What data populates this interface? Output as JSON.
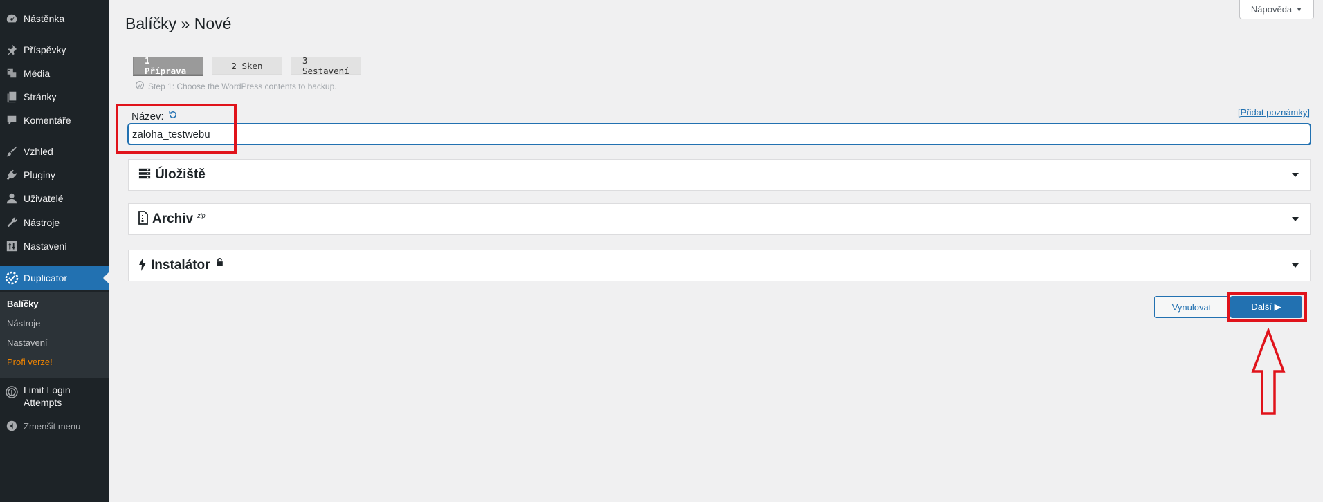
{
  "sidebar": {
    "items": [
      {
        "label": "Nástěnka",
        "icon": "dashboard-icon"
      },
      {
        "label": "Příspěvky",
        "icon": "pin-icon"
      },
      {
        "label": "Média",
        "icon": "media-icon"
      },
      {
        "label": "Stránky",
        "icon": "pages-icon"
      },
      {
        "label": "Komentáře",
        "icon": "comment-icon"
      },
      {
        "label": "Vzhled",
        "icon": "brush-icon"
      },
      {
        "label": "Pluginy",
        "icon": "plugin-icon"
      },
      {
        "label": "Uživatelé",
        "icon": "user-icon"
      },
      {
        "label": "Nástroje",
        "icon": "wrench-icon"
      },
      {
        "label": "Nastavení",
        "icon": "settings-icon"
      },
      {
        "label": "Duplicator",
        "icon": "duplicator-icon"
      }
    ],
    "submenu": [
      "Balíčky",
      "Nástroje",
      "Nastavení",
      "Profi verze!"
    ],
    "limit_login": "Limit Login Attempts",
    "collapse": "Zmenšit menu"
  },
  "header": {
    "title": "Balíčky » Nové",
    "help": "Nápověda"
  },
  "steps": [
    "1 Příprava",
    "2 Sken",
    "3 Sestavení"
  ],
  "step_note": "Step 1: Choose the WordPress contents to backup.",
  "form": {
    "name_label": "Název:",
    "name_value": "zaloha_testwebu",
    "notes_link": "[Přidat poznámky]"
  },
  "panels": {
    "storage": "Úložiště",
    "archive": "Archiv",
    "archive_sup": "zip",
    "installer": "Instalátor"
  },
  "buttons": {
    "reset": "Vynulovat",
    "next": "Další ▶"
  },
  "colors": {
    "accent": "#2271b1",
    "sidebar": "#1d2327",
    "annotation": "#e0131b"
  }
}
